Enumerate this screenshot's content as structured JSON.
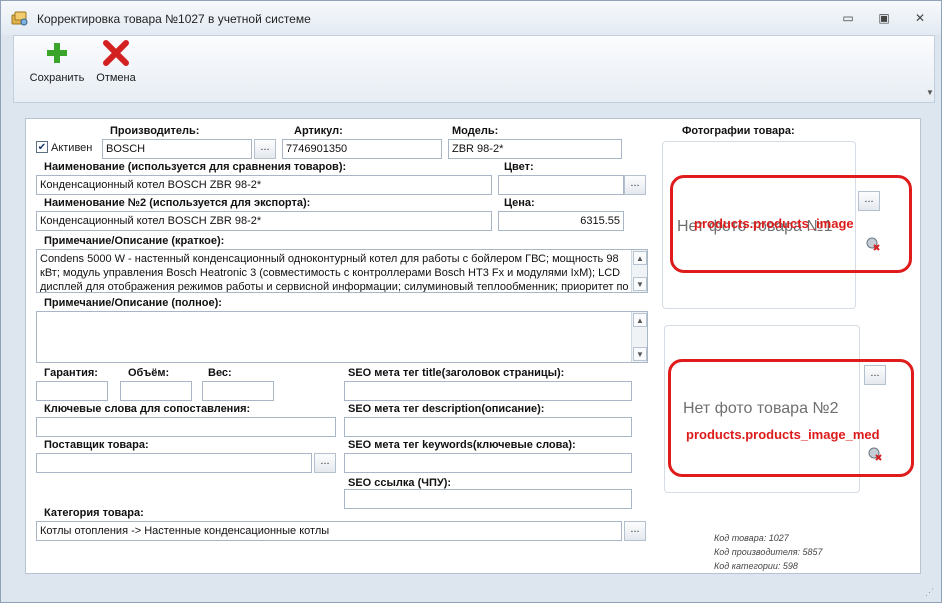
{
  "window": {
    "title": "Корректировка товара №1027 в учетной системе",
    "controls": {
      "minimize": "▭",
      "restore": "▣",
      "close": "✕"
    }
  },
  "toolbar": {
    "save_label": "Сохранить",
    "cancel_label": "Отмена",
    "save_icon": "plus-icon",
    "cancel_icon": "x-icon",
    "save_color": "#3aa52a",
    "cancel_color": "#d32020"
  },
  "form": {
    "manufacturer": {
      "label": "Производитель:",
      "value": "BOSCH"
    },
    "active": {
      "label": "Активен",
      "checked": true,
      "mark": "✔"
    },
    "article": {
      "label": "Артикул:",
      "value": "7746901350"
    },
    "model": {
      "label": "Модель:",
      "value": "ZBR 98-2*"
    },
    "name": {
      "label": "Наименование (используется для сравнения товаров):",
      "value": "Конденсационный котел BOSCH ZBR 98-2*"
    },
    "color": {
      "label": "Цвет:",
      "value": ""
    },
    "name2": {
      "label": "Наименование №2 (используется для экспорта):",
      "value": "Конденсационный котел BOSCH ZBR 98-2*"
    },
    "price": {
      "label": "Цена:",
      "value": "6315.55"
    },
    "desc_short": {
      "label": "Примечание/Описание (краткое):",
      "lines": [
        "Condens 5000 W - настенный конденсационный одноконтурный котел для работы с бойлером ГВС; мощность 98",
        "кВт; модуль управления Bosch Heatronic 3 (совместимость с контроллерами Bosch HT3 Fx и модулями IxM); LCD",
        "дисплей для отображения режимов работы и сервисной информации; силуминовый теплообменник; приоритет по"
      ]
    },
    "desc_full": {
      "label": "Примечание/Описание (полное):",
      "value": ""
    },
    "warranty": {
      "label": "Гарантия:",
      "value": ""
    },
    "volume": {
      "label": "Объём:",
      "value": ""
    },
    "weight": {
      "label": "Вес:",
      "value": ""
    },
    "keywords_match": {
      "label": "Ключевые слова для сопоставления:",
      "value": ""
    },
    "supplier": {
      "label": "Поставщик товара:",
      "value": ""
    },
    "seo_title": {
      "label": "SEO мета тег title(заголовок страницы):",
      "value": ""
    },
    "seo_description": {
      "label": "SEO мета тег description(описание):",
      "value": ""
    },
    "seo_keywords": {
      "label": "SEO мета тег keywords(ключевые слова):",
      "value": ""
    },
    "seo_url": {
      "label": "SEO ссылка (ЧПУ):",
      "value": ""
    },
    "category": {
      "label": "Категория товара:",
      "value": "Котлы отопления -> Настенные конденсационные котлы"
    },
    "browse": "..."
  },
  "photos": {
    "label": "Фотографии товара:",
    "photo1": {
      "placeholder": "Нет фото товара №1",
      "field": "products.products_image"
    },
    "photo2": {
      "placeholder": "Нет фото товара №2",
      "field": "products.products_image_med"
    },
    "annotation_color": "#e01b1b"
  },
  "info": {
    "product_code": "Код товара: 1027",
    "manufacturer_code": "Код производителя: 5857",
    "category_code": "Код категории: 598"
  }
}
